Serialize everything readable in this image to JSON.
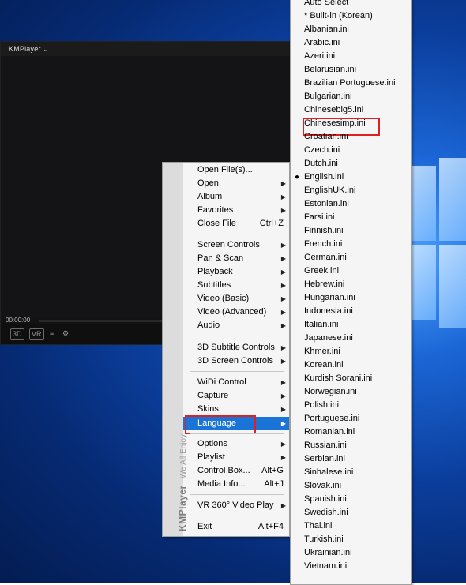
{
  "player": {
    "title": "KMPlayer ⌄",
    "time": "00:00:00",
    "controls": [
      "3D",
      "VR",
      "≡",
      "⚙"
    ]
  },
  "menu": {
    "side_brand": "KMPlayer",
    "side_tagline": "We All Enjoy!",
    "items": [
      {
        "label": "Open File(s)...",
        "accel": "",
        "submenu": false
      },
      {
        "label": "Open",
        "accel": "",
        "submenu": true
      },
      {
        "label": "Album",
        "accel": "",
        "submenu": true
      },
      {
        "label": "Favorites",
        "accel": "",
        "submenu": true
      },
      {
        "label": "Close File",
        "accel": "Ctrl+Z",
        "submenu": false
      },
      {
        "label": "Screen Controls",
        "accel": "",
        "submenu": true
      },
      {
        "label": "Pan & Scan",
        "accel": "",
        "submenu": true
      },
      {
        "label": "Playback",
        "accel": "",
        "submenu": true
      },
      {
        "label": "Subtitles",
        "accel": "",
        "submenu": true
      },
      {
        "label": "Video (Basic)",
        "accel": "",
        "submenu": true
      },
      {
        "label": "Video (Advanced)",
        "accel": "",
        "submenu": true
      },
      {
        "label": "Audio",
        "accel": "",
        "submenu": true
      },
      {
        "label": "3D Subtitle Controls",
        "accel": "",
        "submenu": true
      },
      {
        "label": "3D Screen Controls",
        "accel": "",
        "submenu": true
      },
      {
        "label": "WiDi Control",
        "accel": "",
        "submenu": true
      },
      {
        "label": "Capture",
        "accel": "",
        "submenu": true
      },
      {
        "label": "Skins",
        "accel": "",
        "submenu": true
      },
      {
        "label": "Language",
        "accel": "",
        "submenu": true
      },
      {
        "label": "Options",
        "accel": "",
        "submenu": true
      },
      {
        "label": "Playlist",
        "accel": "",
        "submenu": true
      },
      {
        "label": "Control Box...",
        "accel": "Alt+G",
        "submenu": false
      },
      {
        "label": "Media Info...",
        "accel": "Alt+J",
        "submenu": false
      },
      {
        "label": "VR 360° Video Play",
        "accel": "",
        "submenu": true
      },
      {
        "label": "Exit",
        "accel": "Alt+F4",
        "submenu": false
      }
    ],
    "selected": "Language"
  },
  "language_menu": {
    "items": [
      "Auto Select",
      "* Built-in (Korean)",
      "Albanian.ini",
      "Arabic.ini",
      "Azeri.ini",
      "Belarusian.ini",
      "Brazilian Portuguese.ini",
      "Bulgarian.ini",
      "Chinesebig5.ini",
      "Chinesesimp.ini",
      "Croatian.ini",
      "Czech.ini",
      "Dutch.ini",
      "English.ini",
      "EnglishUK.ini",
      "Estonian.ini",
      "Farsi.ini",
      "Finnish.ini",
      "French.ini",
      "German.ini",
      "Greek.ini",
      "Hebrew.ini",
      "Hungarian.ini",
      "Indonesia.ini",
      "Italian.ini",
      "Japanese.ini",
      "Khmer.ini",
      "Korean.ini",
      "Kurdish Sorani.ini",
      "Norwegian.ini",
      "Polish.ini",
      "Portuguese.ini",
      "Romanian.ini",
      "Russian.ini",
      "Serbian.ini",
      "Sinhalese.ini",
      "Slovak.ini",
      "Spanish.ini",
      "Swedish.ini",
      "Thai.ini",
      "Turkish.ini",
      "Ukrainian.ini",
      "Vietnam.ini"
    ],
    "checked": "English.ini",
    "highlighted": "Chinesesimp.ini",
    "check_glyph": "●"
  }
}
